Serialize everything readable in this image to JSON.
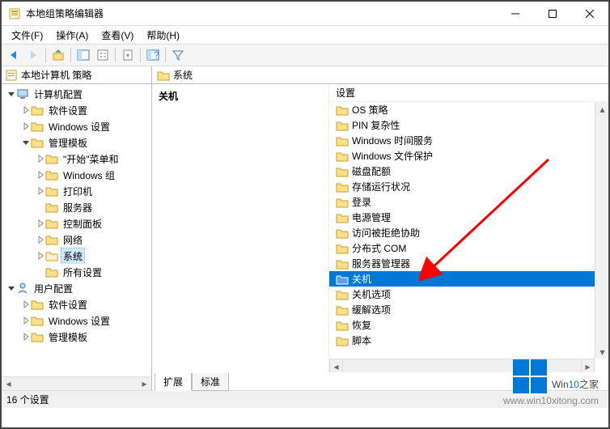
{
  "window": {
    "title": "本地组策略编辑器"
  },
  "menubar": [
    "文件(F)",
    "操作(A)",
    "查看(V)",
    "帮助(H)"
  ],
  "root_node": "本地计算机 策略",
  "tree": [
    {
      "depth": 0,
      "expand": "open",
      "icon": "computer",
      "label": "计算机配置"
    },
    {
      "depth": 1,
      "expand": "closed",
      "icon": "folder",
      "label": "软件设置"
    },
    {
      "depth": 1,
      "expand": "closed",
      "icon": "folder",
      "label": "Windows 设置"
    },
    {
      "depth": 1,
      "expand": "open",
      "icon": "folder",
      "label": "管理模板"
    },
    {
      "depth": 2,
      "expand": "closed",
      "icon": "folder",
      "label": "\"开始\"菜单和"
    },
    {
      "depth": 2,
      "expand": "closed",
      "icon": "folder",
      "label": "Windows 组"
    },
    {
      "depth": 2,
      "expand": "closed",
      "icon": "folder",
      "label": "打印机"
    },
    {
      "depth": 2,
      "expand": "none",
      "icon": "folder",
      "label": "服务器"
    },
    {
      "depth": 2,
      "expand": "closed",
      "icon": "folder",
      "label": "控制面板"
    },
    {
      "depth": 2,
      "expand": "closed",
      "icon": "folder",
      "label": "网络"
    },
    {
      "depth": 2,
      "expand": "closed",
      "icon": "folder",
      "label": "系统",
      "selected": true
    },
    {
      "depth": 2,
      "expand": "none",
      "icon": "folder",
      "label": "所有设置"
    },
    {
      "depth": 0,
      "expand": "open",
      "icon": "user",
      "label": "用户配置"
    },
    {
      "depth": 1,
      "expand": "closed",
      "icon": "folder",
      "label": "软件设置"
    },
    {
      "depth": 1,
      "expand": "closed",
      "icon": "folder",
      "label": "Windows 设置"
    },
    {
      "depth": 1,
      "expand": "closed",
      "icon": "folder",
      "label": "管理模板"
    }
  ],
  "right": {
    "header": "系统",
    "desc_title": "关机",
    "list_header": "设置",
    "items": [
      {
        "label": "OS 策略"
      },
      {
        "label": "PIN 复杂性"
      },
      {
        "label": "Windows 时间服务"
      },
      {
        "label": "Windows 文件保护"
      },
      {
        "label": "磁盘配额"
      },
      {
        "label": "存储运行状况"
      },
      {
        "label": "登录"
      },
      {
        "label": "电源管理"
      },
      {
        "label": "访问被拒绝协助"
      },
      {
        "label": "分布式 COM"
      },
      {
        "label": "服务器管理器"
      },
      {
        "label": "关机",
        "selected": true
      },
      {
        "label": "关机选项"
      },
      {
        "label": "缓解选项"
      },
      {
        "label": "恢复"
      },
      {
        "label": "脚本"
      }
    ]
  },
  "tabs": {
    "extended": "扩展",
    "standard": "标准"
  },
  "statusbar": "16 个设置",
  "watermark": {
    "brand_pre": "Win",
    "brand_accent": "10",
    "brand_post": "之家",
    "url": "www.win10xitong.com"
  }
}
